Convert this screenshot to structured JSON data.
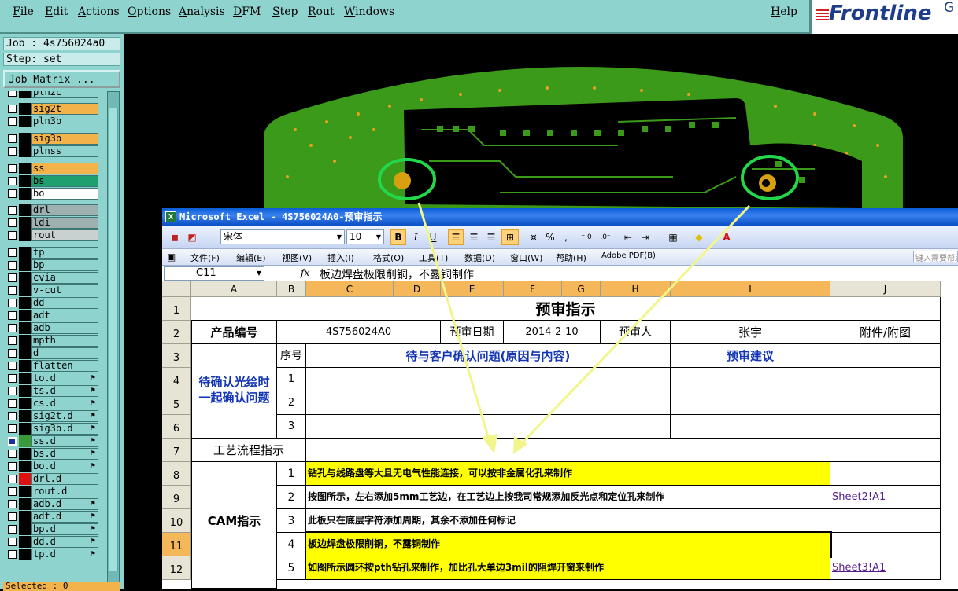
{
  "frontline": {
    "menu": [
      "File",
      "Edit",
      "Actions",
      "Options",
      "Analysis",
      "DFM",
      "Step",
      "Rout",
      "Windows"
    ],
    "help": "Help",
    "logo_text": "Frontline",
    "logo_suffix": "G",
    "job_label": "Job : 4s756024a0",
    "step_label": "Step: set",
    "job_matrix_button": "Job Matrix ...",
    "selected_label": "Selected : 0",
    "layers": [
      {
        "name": "pln2c",
        "style": "plain",
        "swatch": "#000000"
      },
      {
        "name": "sig2t",
        "style": "org",
        "swatch": "#000000"
      },
      {
        "name": "pln3b",
        "style": "plain",
        "swatch": "#000000"
      },
      {
        "name": "sig3b",
        "style": "org",
        "swatch": "#000000"
      },
      {
        "name": "plnss",
        "style": "plain",
        "swatch": "#000000"
      },
      {
        "name": "ss",
        "style": "org",
        "swatch": "#000000"
      },
      {
        "name": "bs",
        "style": "grn",
        "swatch": "#000000"
      },
      {
        "name": "bo",
        "style": "wht",
        "swatch": "#000000"
      },
      {
        "name": "drl",
        "style": "gry",
        "swatch": "#000000"
      },
      {
        "name": "ldi",
        "style": "gry",
        "swatch": "#000000"
      },
      {
        "name": "rout",
        "style": "lgr",
        "swatch": "#000000"
      },
      {
        "name": "tp",
        "style": "plain",
        "swatch": "#000000"
      },
      {
        "name": "bp",
        "style": "plain",
        "swatch": "#000000"
      },
      {
        "name": "cvia",
        "style": "plain",
        "swatch": "#000000"
      },
      {
        "name": "v-cut",
        "style": "plain",
        "swatch": "#000000"
      },
      {
        "name": "dd",
        "style": "plain",
        "swatch": "#000000"
      },
      {
        "name": "adt",
        "style": "plain",
        "swatch": "#000000"
      },
      {
        "name": "adb",
        "style": "plain",
        "swatch": "#000000"
      },
      {
        "name": "mpth",
        "style": "plain",
        "swatch": "#000000"
      },
      {
        "name": "d",
        "style": "plain",
        "swatch": "#000000"
      },
      {
        "name": "flatten",
        "style": "plain",
        "swatch": "#000000"
      },
      {
        "name": "to.d",
        "style": "plain",
        "swatch": "#000000",
        "flag": true
      },
      {
        "name": "ts.d",
        "style": "plain",
        "swatch": "#000000",
        "flag": true
      },
      {
        "name": "cs.d",
        "style": "plain",
        "swatch": "#000000",
        "flag": true
      },
      {
        "name": "sig2t.d",
        "style": "plain",
        "swatch": "#000000",
        "flag": true
      },
      {
        "name": "sig3b.d",
        "style": "plain",
        "swatch": "#000000",
        "flag": true
      },
      {
        "name": "ss.d",
        "style": "plain",
        "swatch": "#3a9a3a",
        "flag": true,
        "active": true
      },
      {
        "name": "bs.d",
        "style": "plain",
        "swatch": "#000000",
        "flag": true
      },
      {
        "name": "bo.d",
        "style": "plain",
        "swatch": "#000000",
        "flag": true
      },
      {
        "name": "drl.d",
        "style": "plain",
        "swatch": "#e01010"
      },
      {
        "name": "rout.d",
        "style": "plain",
        "swatch": "#000000"
      },
      {
        "name": "adb.d",
        "style": "plain",
        "swatch": "#000000",
        "flag": true
      },
      {
        "name": "adt.d",
        "style": "plain",
        "swatch": "#000000",
        "flag": true
      },
      {
        "name": "bp.d",
        "style": "plain",
        "swatch": "#000000",
        "flag": true
      },
      {
        "name": "dd.d",
        "style": "plain",
        "swatch": "#000000",
        "flag": true
      },
      {
        "name": "tp.d",
        "style": "plain",
        "swatch": "#000000",
        "flag": true
      }
    ]
  },
  "excel": {
    "title": "Microsoft Excel - 4S756024A0-预审指示",
    "font_name": "宋体",
    "font_size": "10",
    "toolbar_bold": "B",
    "toolbar_italic": "I",
    "toolbar_underline": "U",
    "percent": "%",
    "comma": ",",
    "menu": [
      "文件(F)",
      "编辑(E)",
      "视图(V)",
      "插入(I)",
      "格式(O)",
      "工具(T)",
      "数据(D)",
      "窗口(W)",
      "帮助(H)",
      "Adobe PDF(B)"
    ],
    "help_placeholder": "键入需要帮助的问题",
    "name_box": "C11",
    "fx": "fx",
    "formula": "板边焊盘极限削铜，不露铜制作",
    "columns": [
      "A",
      "B",
      "C",
      "D",
      "E",
      "F",
      "G",
      "H",
      "I",
      "J"
    ],
    "rows": [
      "1",
      "2",
      "3",
      "4",
      "5",
      "6",
      "7",
      "8",
      "9",
      "10",
      "11",
      "12"
    ],
    "sheet": {
      "title": "预审指示",
      "product_no_label": "产品编号",
      "product_no": "4S756024A0",
      "review_date_label": "预审日期",
      "review_date": "2014-2-10",
      "reviewer_label": "预审人",
      "reviewer": "张宇",
      "attachment_label": "附件/附图",
      "pending_label": "待确认光绘时一起确认问题",
      "pending_label_line1": "待确认光绘时",
      "pending_label_line2": "一起确认问题",
      "seq_header": "序号",
      "issue_header": "待与客户确认问题(原因与内容)",
      "suggestion_header": "预审建议",
      "pending_seq": [
        "1",
        "2",
        "3"
      ],
      "process_label": "工艺流程指示",
      "cam_label": "CAM指示",
      "cam_items": [
        {
          "seq": "1",
          "text": "钻孔与线路盘等大且无电气性能连接，可以按非金属化孔来制作",
          "highlight": true,
          "link": ""
        },
        {
          "seq": "2",
          "text": "按图所示，左右添加5mm工艺边，在工艺边上按我司常规添加反光点和定位孔来制作",
          "highlight": false,
          "link": "Sheet2!A1"
        },
        {
          "seq": "3",
          "text": "此板只在底层字符添加周期，其余不添加任何标记",
          "highlight": false,
          "link": ""
        },
        {
          "seq": "4",
          "text": "板边焊盘极限削铜，不露铜制作",
          "highlight": true,
          "link": ""
        },
        {
          "seq": "5",
          "text": "如图所示圆环按pth钻孔来制作，加比孔大单边3mil的阻焊开窗来制作",
          "highlight": true,
          "link": "Sheet3!A1"
        }
      ]
    }
  },
  "colors": {
    "frontline_bg": "#8fd3cf",
    "pcb_green": "#3c9a1a",
    "highlight_yellow": "#ffff00",
    "annotation_circle": "#22d84a",
    "annotation_arrow": "#f2f58a"
  }
}
